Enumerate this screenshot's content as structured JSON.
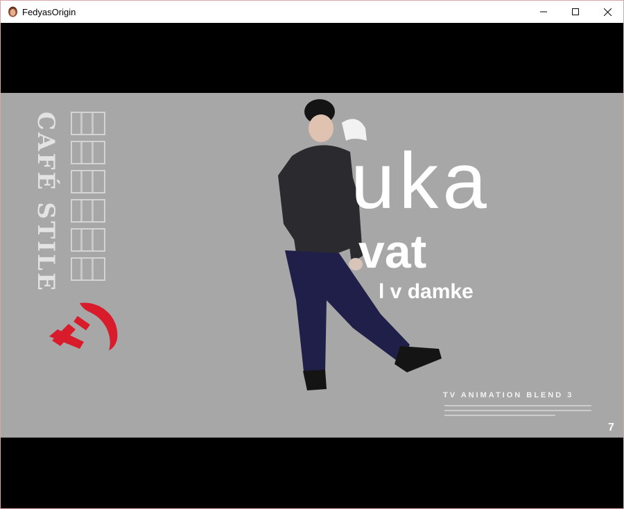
{
  "window": {
    "title": "FedyasOrigin",
    "app_icon": "avatar-icon",
    "controls": {
      "minimize_icon": "minimize-icon",
      "maximize_icon": "maximize-icon",
      "close_icon": "close-icon"
    }
  },
  "video": {
    "side_text": "CAFÉ STILE",
    "emblem_icon": "hammer-sickle-icon",
    "headline": "uka",
    "subline": "vat",
    "tagline": "l v damke",
    "credit": "TV ANIMATION BLEND 3",
    "corner_number": "7"
  },
  "colors": {
    "letterbox": "#000000",
    "video_background": "#a7a7a7",
    "emblem": "#d91c2b",
    "titlebar": "#ffffff"
  }
}
